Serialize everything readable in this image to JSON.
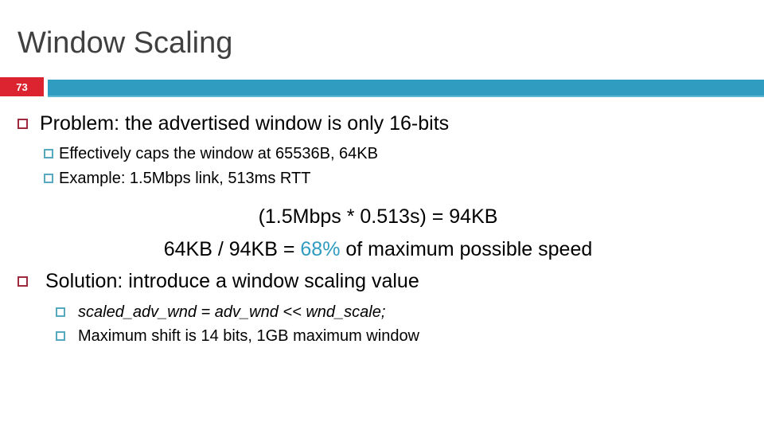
{
  "slide": {
    "title": "Window Scaling",
    "number": "73",
    "accent_color": "#2f9cc0",
    "badge_color": "#dc2430",
    "title_color": "#404040",
    "level1_marker_color": "#9e2a3d",
    "level2_marker_color": "#57a9bf"
  },
  "content": {
    "problem": {
      "text": "Problem: the advertised window is only 16-bits",
      "sub": [
        "Effectively caps the window at 65536B, 64KB",
        "Example: 1.5Mbps link, 513ms RTT"
      ]
    },
    "calculations": {
      "line1": "(1.5Mbps * 0.513s) = 94KB",
      "line2_prefix": "64KB / 94KB = ",
      "line2_highlight": "68%",
      "line2_suffix": " of maximum possible speed"
    },
    "solution": {
      "text": "Solution: introduce a window scaling value",
      "sub_italic": "scaled_adv_wnd = adv_wnd << wnd_scale;",
      "sub_plain": "Maximum shift is 14 bits, 1GB maximum window"
    }
  }
}
